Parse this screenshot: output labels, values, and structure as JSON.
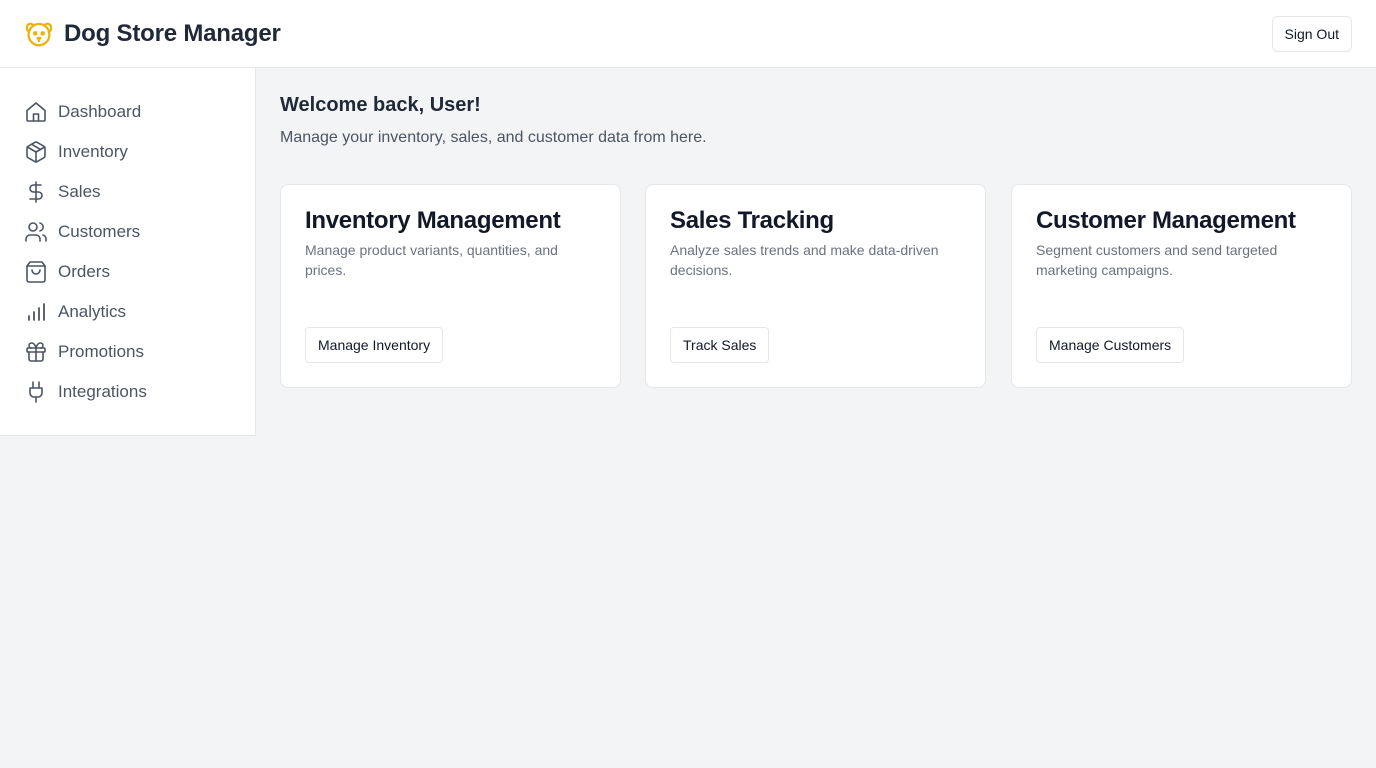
{
  "header": {
    "app_title": "Dog Store Manager",
    "logo_icon": "dog-icon",
    "logo_color": "#eab308",
    "sign_out_label": "Sign Out"
  },
  "sidebar": {
    "items": [
      {
        "label": "Dashboard",
        "icon": "home-icon"
      },
      {
        "label": "Inventory",
        "icon": "package-icon"
      },
      {
        "label": "Sales",
        "icon": "dollar-icon"
      },
      {
        "label": "Customers",
        "icon": "users-icon"
      },
      {
        "label": "Orders",
        "icon": "shopping-bag-icon"
      },
      {
        "label": "Analytics",
        "icon": "bar-chart-icon"
      },
      {
        "label": "Promotions",
        "icon": "gift-icon"
      },
      {
        "label": "Integrations",
        "icon": "plug-icon"
      }
    ]
  },
  "main": {
    "welcome": "Welcome back, User!",
    "subtitle": "Manage your inventory, sales, and customer data from here.",
    "cards": [
      {
        "title": "Inventory Management",
        "description": "Manage product variants, quantities, and prices.",
        "button": "Manage Inventory"
      },
      {
        "title": "Sales Tracking",
        "description": "Analyze sales trends and make data-driven decisions.",
        "button": "Track Sales"
      },
      {
        "title": "Customer Management",
        "description": "Segment customers and send targeted marketing campaigns.",
        "button": "Manage Customers"
      }
    ]
  }
}
